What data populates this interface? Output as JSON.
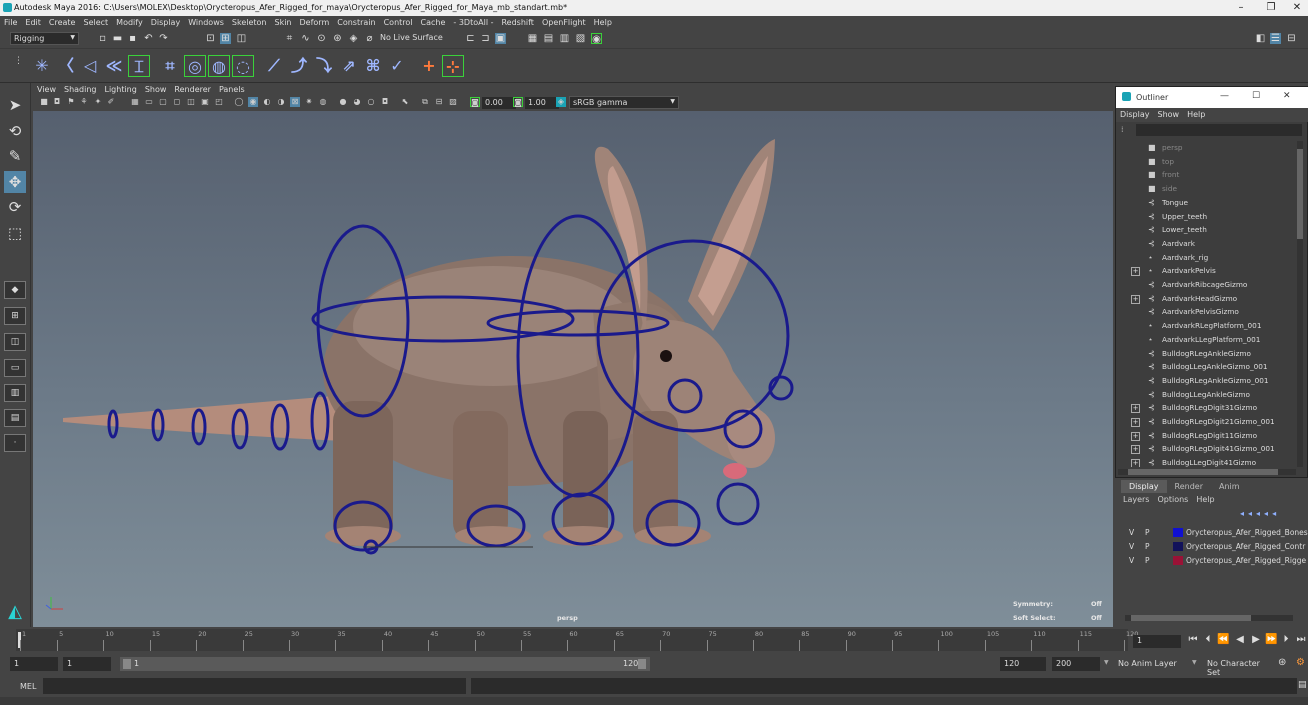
{
  "window": {
    "title": "Autodesk Maya 2016: C:\\Users\\MOLEX\\Desktop\\Orycteropus_Afer_Rigged_for_maya\\Orycteropus_Afer_Rigged_for_Maya_mb_standart.mb*",
    "minimize": "–",
    "restore": "❐",
    "close": "✕"
  },
  "menu": [
    "File",
    "Edit",
    "Create",
    "Select",
    "Modify",
    "Display",
    "Windows",
    "Skeleton",
    "Skin",
    "Deform",
    "Constrain",
    "Control",
    "Cache",
    "- 3DtoAll -",
    "Redshift",
    "OpenFlight",
    "Help"
  ],
  "status": {
    "mode": "Rigging",
    "live_surface": "No Live Surface"
  },
  "viewport": {
    "menu": [
      "View",
      "Shading",
      "Lighting",
      "Show",
      "Renderer",
      "Panels"
    ],
    "exposure": "0.00",
    "gamma_value": "1.00",
    "color_space": "sRGB gamma",
    "camera": "persp",
    "hud": {
      "symmetry_label": "Symmetry:",
      "symmetry_value": "Off",
      "soft_select_label": "Soft Select:",
      "soft_select_value": "Off"
    }
  },
  "outliner": {
    "title": "Outliner",
    "menu": [
      "Display",
      "Show",
      "Help"
    ],
    "items": [
      {
        "label": "persp",
        "icon": "camera-icon",
        "dim": true,
        "expand": false
      },
      {
        "label": "top",
        "icon": "camera-icon",
        "dim": true,
        "expand": false
      },
      {
        "label": "front",
        "icon": "camera-icon",
        "dim": true,
        "expand": false
      },
      {
        "label": "side",
        "icon": "camera-icon",
        "dim": true,
        "expand": false
      },
      {
        "label": "Tongue",
        "icon": "transform-icon",
        "dim": false,
        "expand": false
      },
      {
        "label": "Upper_teeth",
        "icon": "transform-icon",
        "dim": false,
        "expand": false
      },
      {
        "label": "Lower_teeth",
        "icon": "transform-icon",
        "dim": false,
        "expand": false
      },
      {
        "label": "Aardvark",
        "icon": "transform-icon",
        "dim": false,
        "expand": false
      },
      {
        "label": "Aardvark_rig",
        "icon": "joint-icon",
        "dim": false,
        "expand": false
      },
      {
        "label": "AardvarkPelvis",
        "icon": "joint-icon",
        "dim": false,
        "expand": true
      },
      {
        "label": "AardvarkRibcageGizmo",
        "icon": "transform-icon",
        "dim": false,
        "expand": false
      },
      {
        "label": "AardvarkHeadGizmo",
        "icon": "transform-icon",
        "dim": false,
        "expand": true
      },
      {
        "label": "AardvarkPelvisGizmo",
        "icon": "transform-icon",
        "dim": false,
        "expand": false
      },
      {
        "label": "AardvarkRLegPlatform_001",
        "icon": "joint-icon",
        "dim": false,
        "expand": false
      },
      {
        "label": "AardvarkLLegPlatform_001",
        "icon": "joint-icon",
        "dim": false,
        "expand": false
      },
      {
        "label": "BulldogRLegAnkleGizmo",
        "icon": "transform-icon",
        "dim": false,
        "expand": false
      },
      {
        "label": "BulldogLLegAnkleGizmo_001",
        "icon": "transform-icon",
        "dim": false,
        "expand": false
      },
      {
        "label": "BulldogRLegAnkleGizmo_001",
        "icon": "transform-icon",
        "dim": false,
        "expand": false
      },
      {
        "label": "BulldogLLegAnkleGizmo",
        "icon": "transform-icon",
        "dim": false,
        "expand": false
      },
      {
        "label": "BulldogRLegDigit31Gizmo",
        "icon": "transform-icon",
        "dim": false,
        "expand": true
      },
      {
        "label": "BulldogRLegDigit21Gizmo_001",
        "icon": "transform-icon",
        "dim": false,
        "expand": true
      },
      {
        "label": "BulldogRLegDigit11Gizmo",
        "icon": "transform-icon",
        "dim": false,
        "expand": true
      },
      {
        "label": "BulldogRLegDigit41Gizmo_001",
        "icon": "transform-icon",
        "dim": false,
        "expand": true
      },
      {
        "label": "BulldogLLegDigit41Gizmo",
        "icon": "transform-icon",
        "dim": false,
        "expand": true
      }
    ]
  },
  "channel_box": {
    "tabs": [
      "Display",
      "Render",
      "Anim"
    ],
    "menu": [
      "Layers",
      "Options",
      "Help"
    ],
    "layers": [
      {
        "v": "V",
        "p": "P",
        "name": "Orycteropus_Afer_Rigged_Bones",
        "color": "#1010d0"
      },
      {
        "v": "V",
        "p": "P",
        "name": "Orycteropus_Afer_Rigged_Contr",
        "color": "#12125a"
      },
      {
        "v": "V",
        "p": "P",
        "name": "Orycteropus_Afer_Rigged_Rigge",
        "color": "#9a1236"
      }
    ]
  },
  "timeline": {
    "tick_labels": [
      "1",
      "5",
      "10",
      "15",
      "20",
      "25",
      "30",
      "35",
      "40",
      "45",
      "50",
      "55",
      "60",
      "65",
      "70",
      "75",
      "80",
      "85",
      "90",
      "95",
      "100",
      "105",
      "110",
      "115",
      "120"
    ],
    "current_frame": "1",
    "range_start": "1",
    "playback_start": "1",
    "slider_start": "1",
    "slider_end": "120",
    "playback_end": "120",
    "range_end": "200",
    "anim_layer": "No Anim Layer",
    "character_set": "No Character Set"
  },
  "command_line": {
    "label": "MEL"
  },
  "colors": {
    "rig_control": "#1a1a8c",
    "viewport_top": "#56606f",
    "viewport_bottom": "#7f8e99",
    "select_highlight": "#5285a6"
  }
}
